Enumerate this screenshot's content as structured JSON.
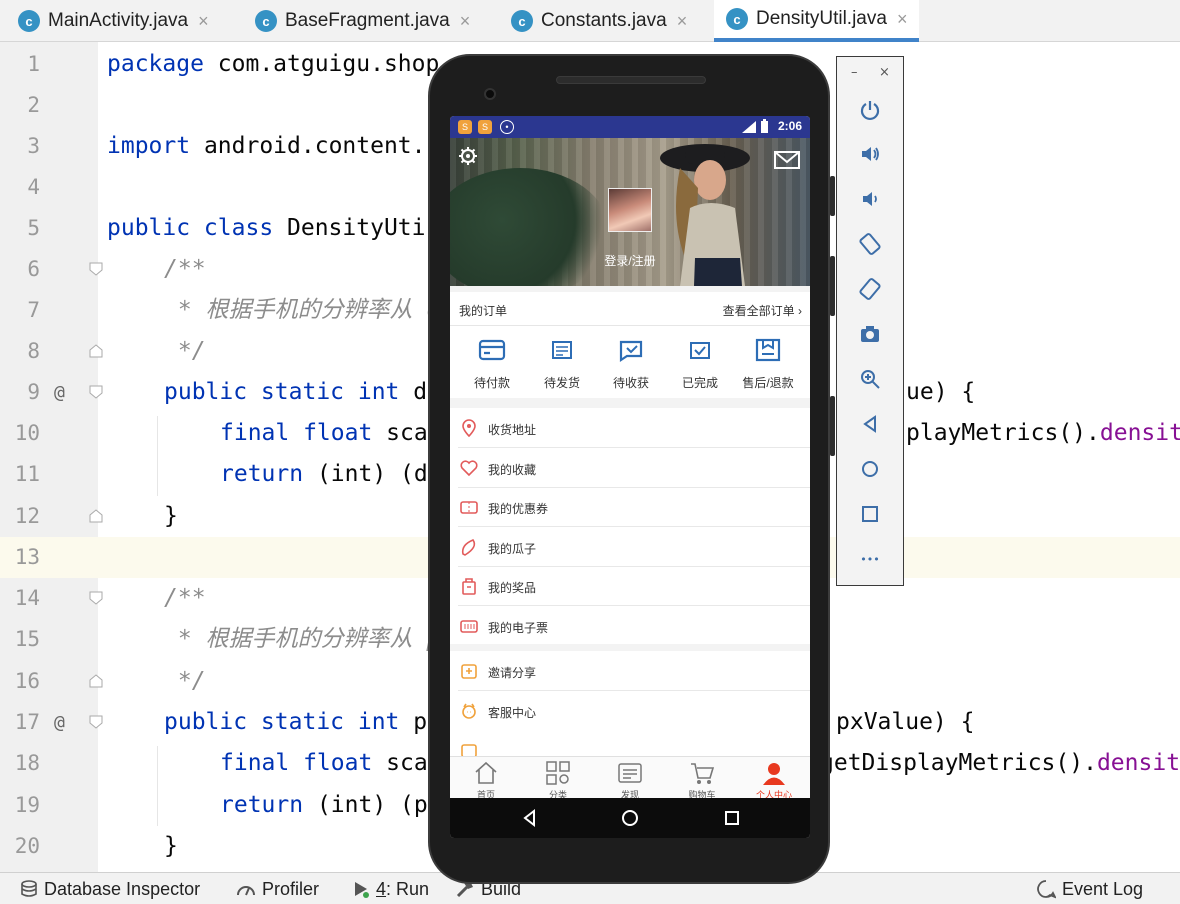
{
  "tabs": [
    {
      "label": "MainActivity.java",
      "active": false
    },
    {
      "label": "BaseFragment.java",
      "active": false
    },
    {
      "label": "Constants.java",
      "active": false
    },
    {
      "label": "DensityUtil.java",
      "active": true
    }
  ],
  "tab_icon_letter": "c",
  "tab_close_glyph": "×",
  "editor": {
    "line_numbers": [
      "1",
      "2",
      "3",
      "4",
      "5",
      "6",
      "7",
      "8",
      "9",
      "10",
      "11",
      "12",
      "13",
      "14",
      "15",
      "16",
      "17",
      "18",
      "19",
      "20"
    ],
    "override_marker": "@",
    "code": {
      "l1_kw": "package",
      "l1_rest": " com.atguigu.shop",
      "l3_kw": "import",
      "l3_rest": " android.content.",
      "l5_kw": "public class",
      "l5_rest": " DensityUti",
      "l6": "/**",
      "l7": " * 根据手机的分辨率从 d",
      "l8": " */",
      "l9_kw": "public static int",
      "l9_rest": " d",
      "l9_right": "ue) {",
      "l10_kw": "final float",
      "l10_rest": " sca",
      "l10_right": "playMetrics().",
      "l10_purple": "densit",
      "l11_kw": "return",
      "l11_rest": " (int) (d",
      "l12": "}",
      "l14": "/**",
      "l15": " * 根据手机的分辨率从 p",
      "l16": " */",
      "l17_kw": "public static int",
      "l17_rest": " p",
      "l17_right": "pxValue) {",
      "l18_kw": "final float",
      "l18_rest": " sca",
      "l18_right": "getDisplayMetrics().",
      "l18_purple": "densit",
      "l19_kw": "return",
      "l19_rest": " (int) (p",
      "l20": "}"
    }
  },
  "statusbar": {
    "database_inspector": "Database Inspector",
    "profiler": "Profiler",
    "run_number": "4",
    "run_label": ": Run",
    "build": "Build",
    "event_log": "Event Log"
  },
  "phone": {
    "time": "2:06",
    "login_label": "登录/注册",
    "orders_title": "我的订单",
    "orders_all": "查看全部订单",
    "order_items": [
      "待付款",
      "待发货",
      "待收获",
      "已完成",
      "售后/退款"
    ],
    "menu_items": [
      "收货地址",
      "我的收藏",
      "我的优惠券",
      "我的瓜子",
      "我的奖品",
      "我的电子票",
      "邀请分享",
      "客服中心"
    ],
    "bottom_nav": [
      "首页",
      "分类",
      "发现",
      "购物车",
      "个人中心"
    ],
    "accent_color": "#e8391f",
    "icon_color": "#2d6db5"
  },
  "emulator": {
    "minimize": "–",
    "close": "×",
    "more": "•••"
  }
}
